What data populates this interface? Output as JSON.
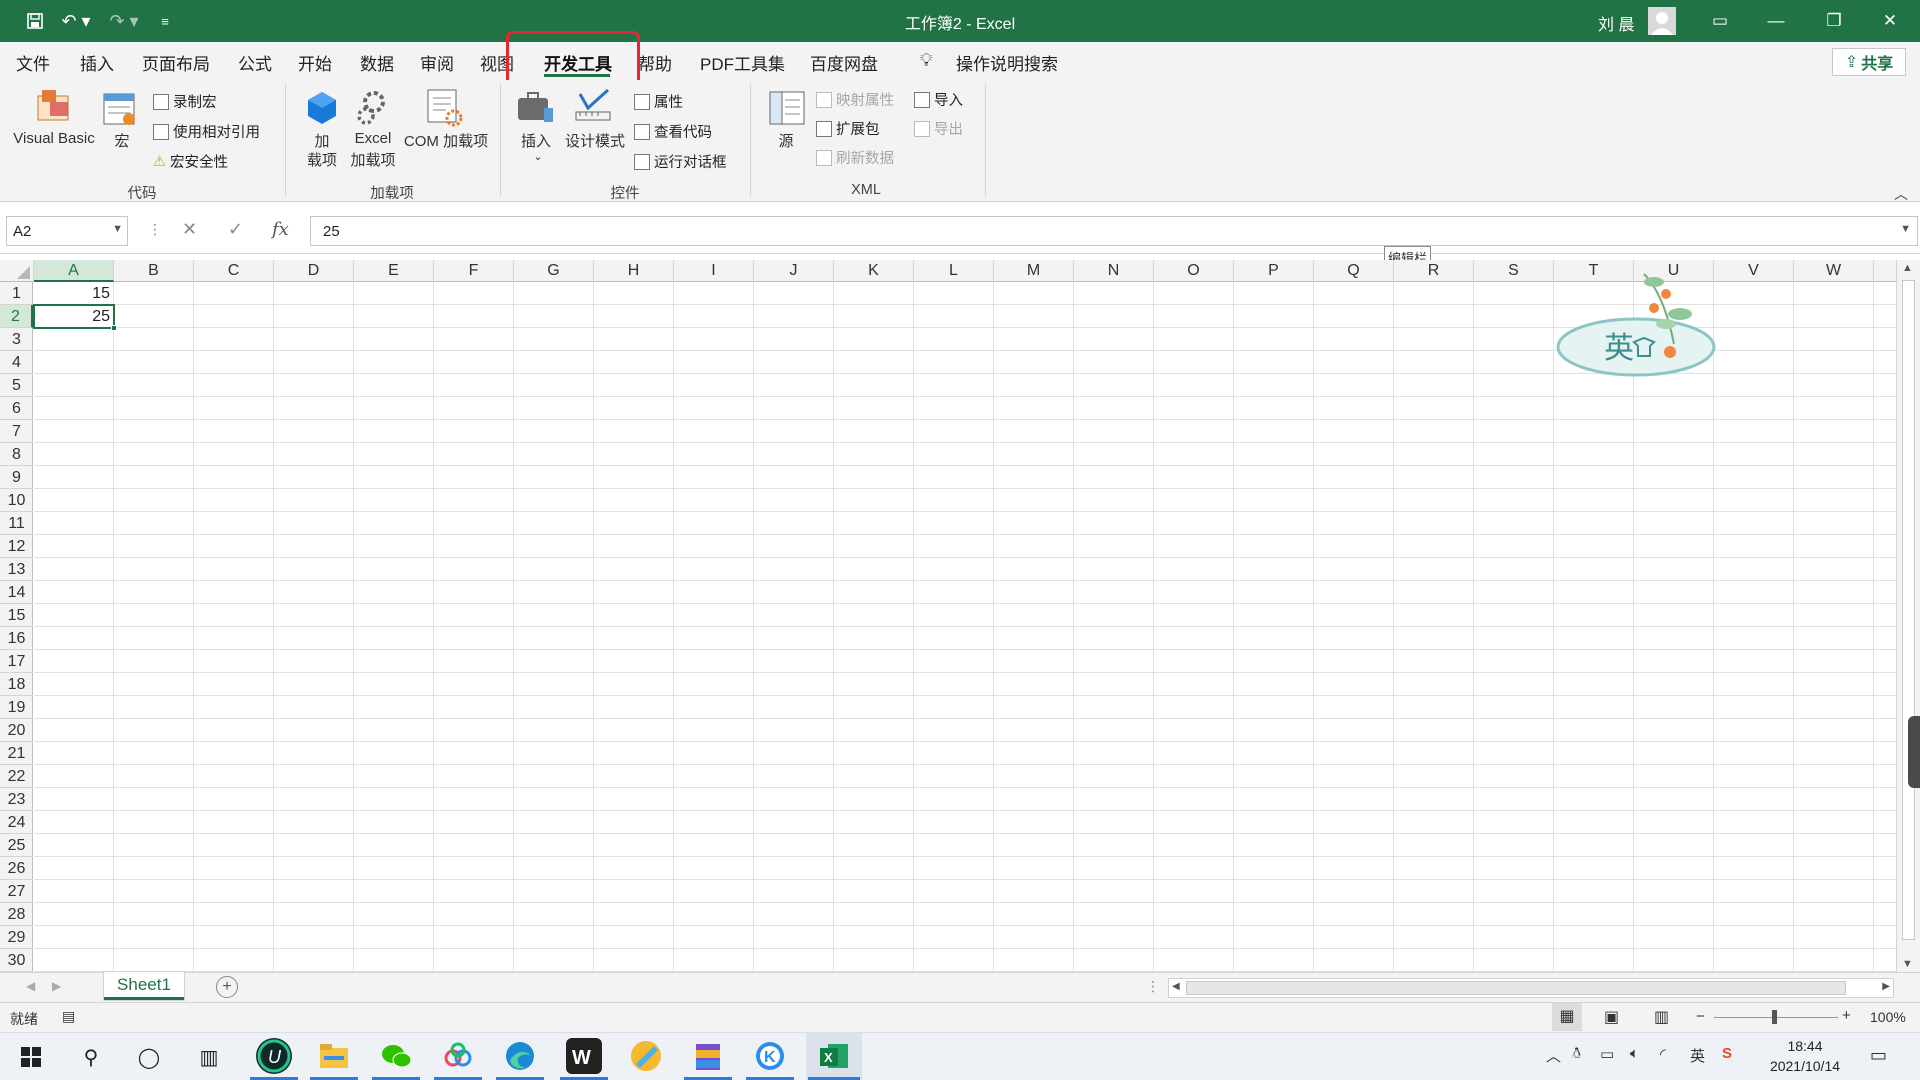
{
  "window": {
    "title": "工作簿2  -  Excel",
    "user": "刘 晨",
    "quick_access": [
      "save-icon",
      "undo-icon",
      "redo-icon",
      "customize-icon"
    ],
    "controls": [
      "ribbon-display-icon",
      "minimize-icon",
      "restore-icon",
      "close-icon"
    ]
  },
  "menu": {
    "tabs": [
      "文件",
      "插入",
      "页面布局",
      "公式",
      "开始",
      "数据",
      "审阅",
      "视图",
      "开发工具",
      "帮助",
      "PDF工具集",
      "百度网盘"
    ],
    "active_tab": "开发工具",
    "search": "操作说明搜索",
    "share": "共享"
  },
  "ribbon": {
    "code": {
      "group": "代码",
      "visual_basic": "Visual Basic",
      "macro": "宏",
      "record_macro": "录制宏",
      "relative_ref": "使用相对引用",
      "macro_security": "宏安全性"
    },
    "addins": {
      "group": "加载项",
      "addin_line1": "加",
      "addin_line2": "载项",
      "excel_addin_line1": "Excel",
      "excel_addin_line2": "加载项",
      "com_addin": "COM 加载项"
    },
    "controls": {
      "group": "控件",
      "insert": "插入",
      "design_mode": "设计模式",
      "properties": "属性",
      "view_code": "查看代码",
      "run_dialog": "运行对话框"
    },
    "xml": {
      "group": "XML",
      "source": "源",
      "map_properties": "映射属性",
      "expansion_packs": "扩展包",
      "refresh_data": "刷新数据",
      "import": "导入",
      "export": "导出"
    }
  },
  "formula_bar": {
    "name_box": "A2",
    "formula": "25",
    "tooltip": "编辑栏"
  },
  "grid": {
    "columns": [
      "A",
      "B",
      "C",
      "D",
      "E",
      "F",
      "G",
      "H",
      "I",
      "J",
      "K",
      "L",
      "M",
      "N",
      "O",
      "P",
      "Q",
      "R",
      "S",
      "T",
      "U",
      "V",
      "W"
    ],
    "rows": [
      "1",
      "2",
      "3",
      "4",
      "5",
      "6",
      "7",
      "8",
      "9",
      "10",
      "11",
      "12",
      "13",
      "14",
      "15",
      "16",
      "17",
      "18",
      "19",
      "20",
      "21",
      "22",
      "23",
      "24",
      "25",
      "26",
      "27",
      "28",
      "29",
      "30"
    ],
    "cells": {
      "A1": "15",
      "A2": "25"
    },
    "selected_cell": "A2"
  },
  "sheets": {
    "tabs": [
      "Sheet1"
    ],
    "active": "Sheet1"
  },
  "status": {
    "ready": "就绪",
    "zoom": "100%"
  },
  "ime_watermark": "英",
  "taskbar": {
    "time": "18:44",
    "date": "2021/10/14",
    "ime_indicator": "英"
  },
  "colors": {
    "excel_green": "#217346",
    "highlight_red": "#e8262f"
  }
}
